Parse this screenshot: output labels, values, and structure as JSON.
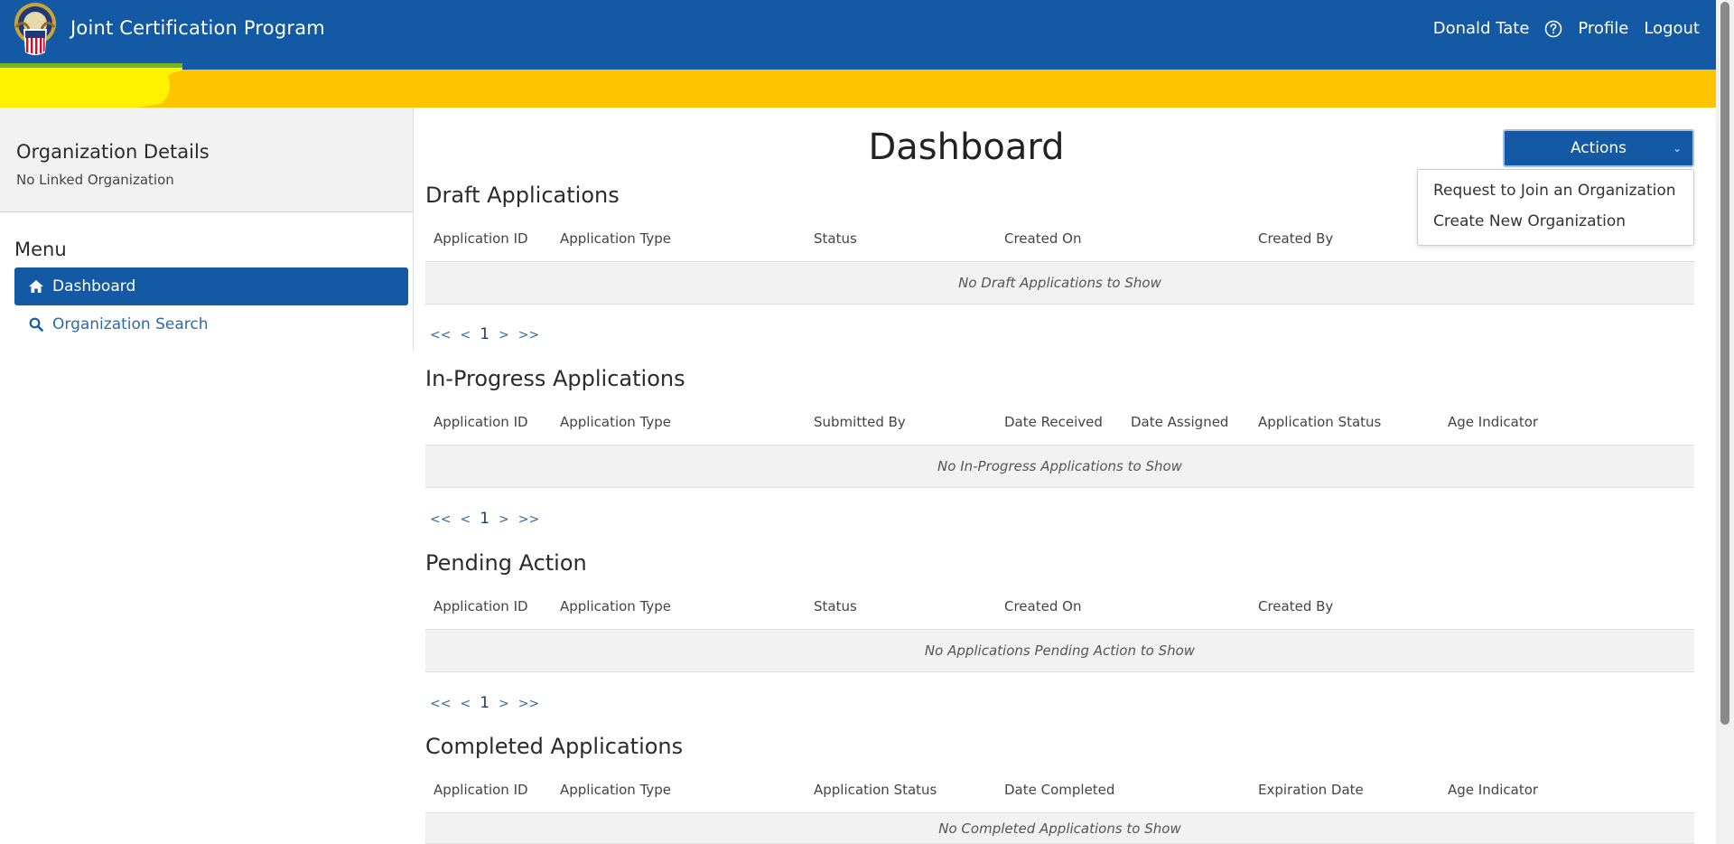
{
  "header": {
    "app_title": "Joint Certification Program",
    "user_name": "Donald Tate",
    "profile_label": "Profile",
    "logout_label": "Logout"
  },
  "sidebar": {
    "org_title": "Organization Details",
    "org_status": "No Linked Organization",
    "menu_title": "Menu",
    "items": [
      {
        "label": "Dashboard",
        "icon": "home-icon"
      },
      {
        "label": "Organization Search",
        "icon": "search-icon"
      }
    ]
  },
  "main": {
    "title": "Dashboard",
    "actions_label": "Actions",
    "actions_menu": [
      "Request to Join an Organization",
      "Create New Organization"
    ],
    "pager": {
      "first": "<<",
      "prev": "<",
      "current": "1",
      "next": ">",
      "last": ">>"
    },
    "sections": [
      {
        "title": "Draft Applications",
        "columns": [
          "Application ID",
          "Application Type",
          "Status",
          "Created On",
          "Created By"
        ],
        "empty_text": "No Draft Applications to Show"
      },
      {
        "title": "In-Progress Applications",
        "columns": [
          "Application ID",
          "Application Type",
          "Submitted By",
          "Date Received",
          "Date Assigned",
          "Application Status",
          "Age Indicator"
        ],
        "empty_text": "No In-Progress Applications to Show"
      },
      {
        "title": "Pending Action",
        "columns": [
          "Application ID",
          "Application Type",
          "Status",
          "Created On",
          "Created By"
        ],
        "empty_text": "No Applications Pending Action to Show"
      },
      {
        "title": "Completed Applications",
        "columns": [
          "Application ID",
          "Application Type",
          "Application Status",
          "Date Completed",
          "Expiration Date",
          "Age Indicator"
        ],
        "empty_text": "No Completed Applications to Show"
      }
    ]
  },
  "colors": {
    "primary": "#1359a3",
    "banner": "#ffc400",
    "highlight": "#fff200"
  }
}
